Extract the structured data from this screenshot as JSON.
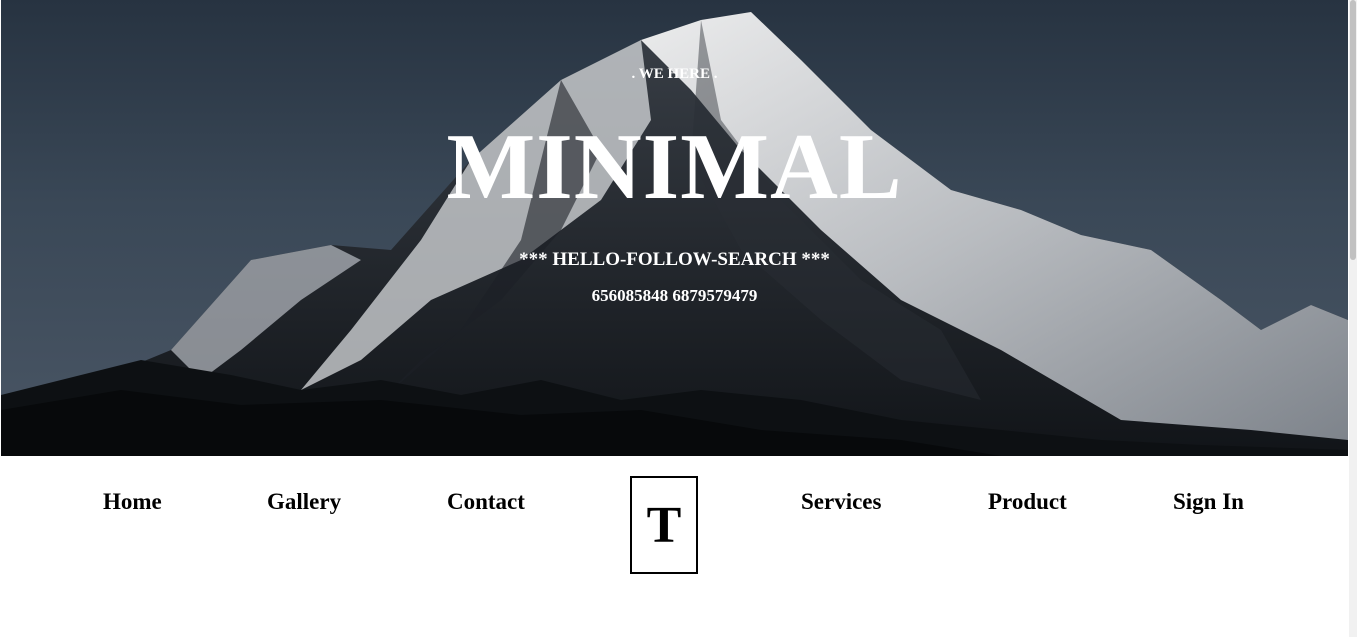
{
  "hero": {
    "tagline": ". WE HERE .",
    "brand": "MINIMAL",
    "slogan": "*** HELLO-FOLLOW-SEARCH ***",
    "phones": "656085848 6879579479"
  },
  "nav": {
    "items": [
      {
        "label": "Home"
      },
      {
        "label": "Gallery"
      },
      {
        "label": "Contact"
      },
      {
        "label": "Services"
      },
      {
        "label": "Product"
      },
      {
        "label": "Sign In"
      }
    ],
    "logo_letter": "T"
  },
  "colors": {
    "sky": "#2e3a48",
    "text_on_hero": "#ffffff",
    "nav_text": "#000000",
    "page_bg": "#ffffff"
  },
  "icons": [
    "mountain-image"
  ]
}
